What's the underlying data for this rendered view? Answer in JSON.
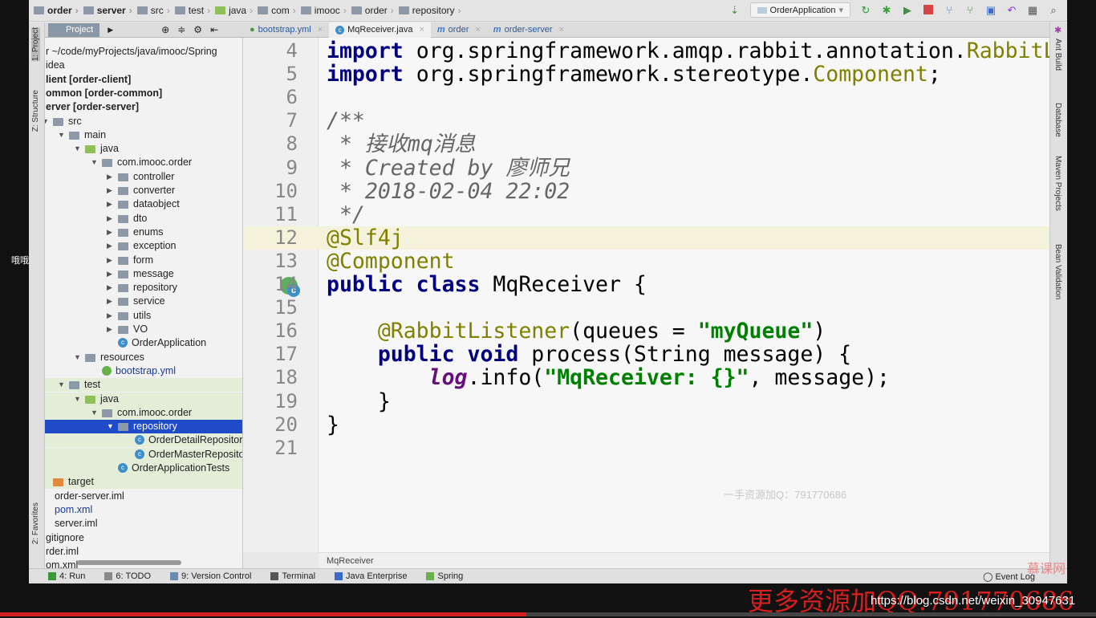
{
  "breadcrumb": [
    "order",
    "server",
    "src",
    "test",
    "java",
    "com",
    "imooc",
    "order",
    "repository"
  ],
  "toolbar": {
    "run_config": "OrderApplication",
    "icons": [
      "sort-icon",
      "rerun-icon",
      "debug-icon",
      "coverage-icon",
      "stop-icon",
      "vcs-update-icon",
      "vcs-commit-icon",
      "compare-icon",
      "revert-icon",
      "structure-icon",
      "search-icon"
    ]
  },
  "project_panel": {
    "label": "Project"
  },
  "editor_tabs": [
    {
      "label": "bootstrap.yml",
      "active": false
    },
    {
      "label": "MqReceiver.java",
      "active": true
    },
    {
      "label": "order",
      "active": false
    },
    {
      "label": "order-server",
      "active": false
    }
  ],
  "left_strip": {
    "project": "1: Project",
    "structure": "Z: Structure",
    "favorites": "2: Favorites"
  },
  "right_strip": [
    "Ant Build",
    "Database",
    "Maven Projects",
    "Bean Validation"
  ],
  "tree": [
    {
      "label": "r ~/code/myProjects/java/imooc/Spring",
      "kind": "text"
    },
    {
      "label": "idea",
      "kind": "text"
    },
    {
      "label": "lient [order-client]",
      "kind": "bold"
    },
    {
      "label": "ommon [order-common]",
      "kind": "bold"
    },
    {
      "label": "erver [order-server]",
      "kind": "bold"
    },
    {
      "label": "src",
      "kind": "folder",
      "expanded": true
    },
    {
      "label": "main",
      "kind": "folder",
      "expanded": true
    },
    {
      "label": "java",
      "kind": "srcfolder",
      "expanded": true
    },
    {
      "label": "com.imooc.order",
      "kind": "folder",
      "expanded": true
    },
    {
      "label": "controller",
      "kind": "folder",
      "expanded": false
    },
    {
      "label": "converter",
      "kind": "folder",
      "expanded": false
    },
    {
      "label": "dataobject",
      "kind": "folder",
      "expanded": false
    },
    {
      "label": "dto",
      "kind": "folder",
      "expanded": false
    },
    {
      "label": "enums",
      "kind": "folder",
      "expanded": false
    },
    {
      "label": "exception",
      "kind": "folder",
      "expanded": false
    },
    {
      "label": "form",
      "kind": "folder",
      "expanded": false
    },
    {
      "label": "message",
      "kind": "folder",
      "expanded": false
    },
    {
      "label": "repository",
      "kind": "folder",
      "expanded": false
    },
    {
      "label": "service",
      "kind": "folder",
      "expanded": false
    },
    {
      "label": "utils",
      "kind": "folder",
      "expanded": false
    },
    {
      "label": "VO",
      "kind": "folder",
      "expanded": false
    },
    {
      "label": "OrderApplication",
      "kind": "class"
    },
    {
      "label": "resources",
      "kind": "folder",
      "expanded": true
    },
    {
      "label": "bootstrap.yml",
      "kind": "yml"
    },
    {
      "label": "test",
      "kind": "folder",
      "expanded": true
    },
    {
      "label": "java",
      "kind": "testfolder",
      "expanded": true
    },
    {
      "label": "com.imooc.order",
      "kind": "folder",
      "expanded": true
    },
    {
      "label": "repository",
      "kind": "folder",
      "expanded": true,
      "selected": true
    },
    {
      "label": "OrderDetailRepository",
      "kind": "class"
    },
    {
      "label": "OrderMasterReposito",
      "kind": "class"
    },
    {
      "label": "OrderApplicationTests",
      "kind": "class"
    },
    {
      "label": "target",
      "kind": "excluded"
    },
    {
      "label": "order-server.iml",
      "kind": "file"
    },
    {
      "label": "pom.xml",
      "kind": "maven"
    },
    {
      "label": "server.iml",
      "kind": "file"
    },
    {
      "label": "gitignore",
      "kind": "text"
    },
    {
      "label": "rder.iml",
      "kind": "text"
    },
    {
      "label": "om.xml",
      "kind": "text"
    }
  ],
  "code": {
    "first_line": 4,
    "highlight_line": 12,
    "lines": [
      [
        [
          "import ",
          "kw"
        ],
        [
          "org.springframework.amqp.rabbit.annotation.",
          "pk"
        ],
        [
          "RabbitListener",
          "cls"
        ],
        [
          ";",
          "pk"
        ]
      ],
      [
        [
          "import ",
          "kw"
        ],
        [
          "org.springframework.stereotype.",
          "pk"
        ],
        [
          "Component",
          "cls"
        ],
        [
          ";",
          "pk"
        ]
      ],
      [],
      [
        [
          "/**",
          "cm"
        ]
      ],
      [
        [
          " * 接收",
          "cm"
        ],
        [
          "mq",
          "cm"
        ],
        [
          "消息",
          "cm"
        ]
      ],
      [
        [
          " * Created by 廖师兄",
          "cm"
        ]
      ],
      [
        [
          " * 2018-02-04 22:02",
          "cm"
        ]
      ],
      [
        [
          " */",
          "cm"
        ]
      ],
      [
        [
          "@Slf4j",
          "ann"
        ]
      ],
      [
        [
          "@Component",
          "ann"
        ]
      ],
      [
        [
          "public class ",
          "kw"
        ],
        [
          "MqReceiver {",
          "pk"
        ]
      ],
      [],
      [
        [
          "    @RabbitListener",
          "ann"
        ],
        [
          "(queues = ",
          "pk"
        ],
        [
          "\"myQueue\"",
          "str"
        ],
        [
          ")",
          "pk"
        ]
      ],
      [
        [
          "    public void ",
          "kw"
        ],
        [
          "process(String message) {",
          "pk"
        ]
      ],
      [
        [
          "        log",
          "fld"
        ],
        [
          ".info(",
          "pk"
        ],
        [
          "\"MqReceiver: {}\"",
          "str"
        ],
        [
          ", message);",
          "pk"
        ]
      ],
      [
        [
          "    }",
          "pk"
        ]
      ],
      [
        [
          "}",
          "pk"
        ]
      ],
      []
    ]
  },
  "editor_watermark": "一手资源加Q：791770686",
  "editor_breadcrumb": "MqReceiver",
  "status_bar": [
    {
      "label": "4: Run",
      "icon": "run-icon"
    },
    {
      "label": "6: TODO",
      "icon": "todo-icon"
    },
    {
      "label": "9: Version Control",
      "icon": "vcs-icon"
    },
    {
      "label": "Terminal",
      "icon": "terminal-icon"
    },
    {
      "label": "Java Enterprise",
      "icon": "java-enterprise-icon"
    },
    {
      "label": "Spring",
      "icon": "spring-icon"
    }
  ],
  "event_log": "Event Log",
  "mooc_logo": "慕课网",
  "promo": "更多资源加QQ:791770686",
  "promo_url": "https://blog.csdn.net/weixin_30947631",
  "side_char": "哦哦",
  "video_progress_percent": 48
}
